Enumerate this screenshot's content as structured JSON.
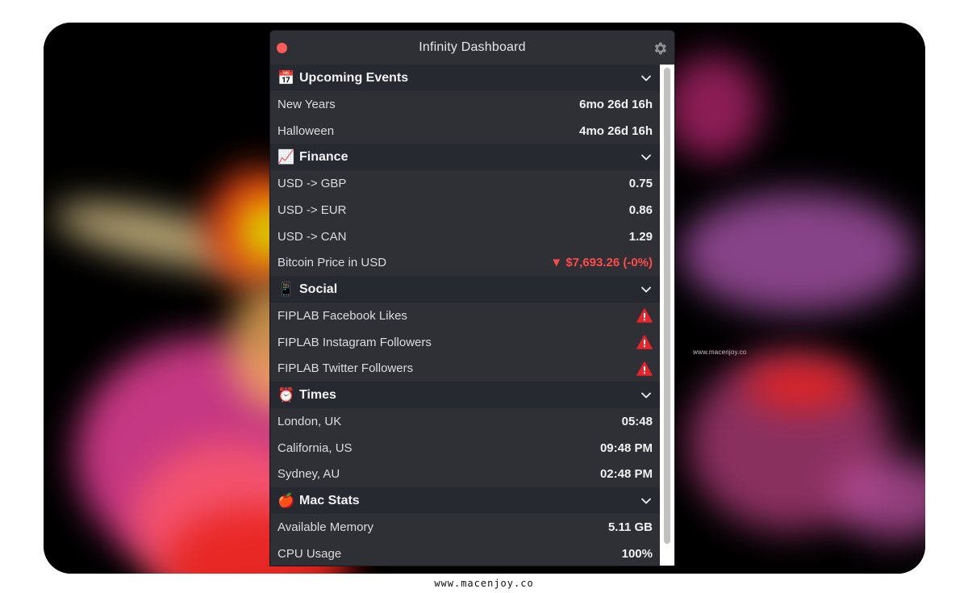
{
  "window": {
    "title": "Infinity Dashboard"
  },
  "sections": [
    {
      "title": "Upcoming Events",
      "icon": "calendar-icon",
      "rows": [
        {
          "label": "New Years",
          "value": "6mo 26d 16h"
        },
        {
          "label": "Halloween",
          "value": "4mo 26d 16h"
        }
      ]
    },
    {
      "title": "Finance",
      "icon": "chart-increasing-icon",
      "rows": [
        {
          "label": "USD -> GBP",
          "value": "0.75"
        },
        {
          "label": "USD -> EUR",
          "value": "0.86"
        },
        {
          "label": "USD -> CAN",
          "value": "1.29"
        },
        {
          "label": "Bitcoin Price in USD",
          "value": "▼ $7,693.26 (-0%)"
        }
      ]
    },
    {
      "title": "Social",
      "icon": "mobile-phone-icon",
      "rows": [
        {
          "label": "FIPLAB Facebook Likes",
          "status": "warning"
        },
        {
          "label": "FIPLAB Instagram Followers",
          "status": "warning"
        },
        {
          "label": "FIPLAB Twitter Followers",
          "status": "warning"
        }
      ]
    },
    {
      "title": "Times",
      "icon": "alarm-clock-icon",
      "rows": [
        {
          "label": "London, UK",
          "value": "05:48"
        },
        {
          "label": "California, US",
          "value": "09:48 PM"
        },
        {
          "label": "Sydney, AU",
          "value": "02:48 PM"
        }
      ]
    },
    {
      "title": "Mac Stats",
      "icon": "apple-icon",
      "rows": [
        {
          "label": "Available Memory",
          "value": "5.11 GB"
        },
        {
          "label": "CPU Usage",
          "value": "100%"
        }
      ]
    }
  ],
  "colors": {
    "close": "#fc5b57",
    "negative": "#ff4a4a",
    "warning": "#e8242b"
  },
  "watermark": "www.macenjoy.co",
  "footer": "www.macenjoy.co"
}
